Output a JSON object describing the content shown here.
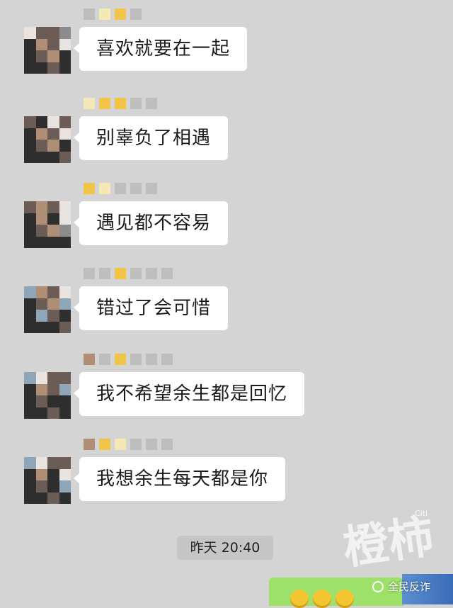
{
  "messages": [
    {
      "text": "喜欢就要在一起"
    },
    {
      "text": "别辜负了相遇"
    },
    {
      "text": "遇见都不容易"
    },
    {
      "text": "错过了会可惜"
    },
    {
      "text": "我不希望余生都是回忆"
    },
    {
      "text": "我想余生每天都是你"
    }
  ],
  "timestamp": "昨天 20:40",
  "watermark": {
    "text": "橙柿",
    "small": "Citi"
  },
  "brand": {
    "text": "全民反诈",
    "icon": "wechat-icon"
  },
  "colors": {
    "background": "#d4d4d4",
    "bubble": "#ffffff",
    "sent_bubble": "#9de16a"
  }
}
